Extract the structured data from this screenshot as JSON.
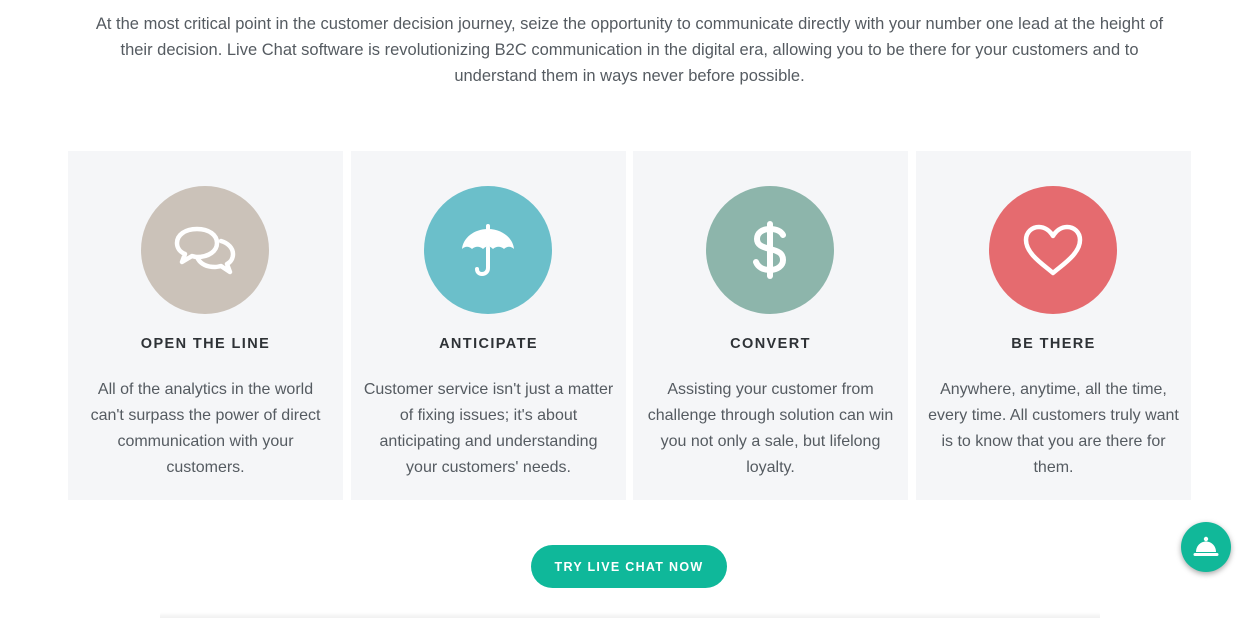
{
  "intro": {
    "text": "At the most critical point in the customer decision journey, seize the opportunity to communicate directly with your number one lead at the height of their decision. Live Chat software is revolutionizing B2C communication in the digital era, allowing you to be there for your customers and to understand them in ways never before possible."
  },
  "features": [
    {
      "title": "OPEN THE LINE",
      "text": "All of the analytics in the world can't surpass the power of direct communication with your customers.",
      "icon": "chat-bubbles-icon",
      "color": "#cbc2b9"
    },
    {
      "title": "ANTICIPATE",
      "text": "Customer service isn't just a matter of fixing issues; it's about anticipating and understanding your customers' needs.",
      "icon": "umbrella-icon",
      "color": "#6bbfca"
    },
    {
      "title": "CONVERT",
      "text": "Assisting your customer from challenge through solution can win you not only a sale, but lifelong loyalty.",
      "icon": "dollar-icon",
      "color": "#8db5ab"
    },
    {
      "title": "BE THERE",
      "text": "Anywhere, anytime, all the time, every time. All customers truly want is to know that you are there for them.",
      "icon": "heart-icon",
      "color": "#e56b6f"
    }
  ],
  "cta": {
    "label": "TRY LIVE CHAT NOW",
    "color": "#0fb89a"
  },
  "chat_widget": {
    "icon": "service-bell-icon",
    "color": "#11b899"
  }
}
